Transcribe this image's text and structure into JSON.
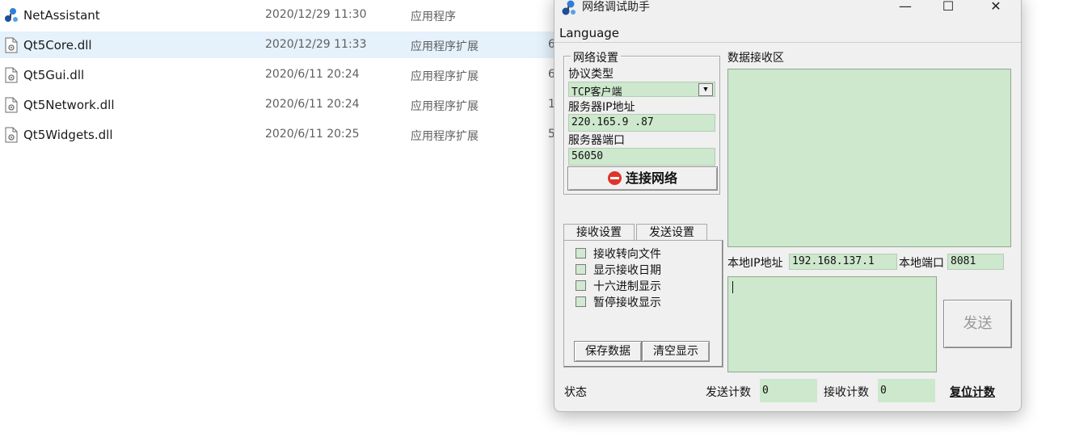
{
  "files": [
    {
      "name": "NetAssistant",
      "date": "2020/12/29 11:30",
      "type": "应用程序",
      "size": "",
      "icon": "app-icon",
      "selected": false
    },
    {
      "name": "Qt5Core.dll",
      "date": "2020/12/29 11:33",
      "type": "应用程序扩展",
      "size": "6",
      "icon": "dll-file-icon",
      "selected": true
    },
    {
      "name": "Qt5Gui.dll",
      "date": "2020/6/11 20:24",
      "type": "应用程序扩展",
      "size": "6",
      "icon": "dll-file-icon",
      "selected": false
    },
    {
      "name": "Qt5Network.dll",
      "date": "2020/6/11 20:24",
      "type": "应用程序扩展",
      "size": "1",
      "icon": "dll-file-icon",
      "selected": false
    },
    {
      "name": "Qt5Widgets.dll",
      "date": "2020/6/11 20:25",
      "type": "应用程序扩展",
      "size": "5",
      "icon": "dll-file-icon",
      "selected": false
    }
  ],
  "window": {
    "title": "网络调试助手",
    "min_glyph": "—",
    "max_glyph": "☐",
    "close_glyph": "✕",
    "menu": [
      "Language"
    ]
  },
  "network": {
    "group_title": "网络设置",
    "protocol_label": "协议类型",
    "protocol_value": "TCP客户端",
    "server_ip_label": "服务器IP地址",
    "server_ip_value": "220.165.9  .87",
    "server_port_label": "服务器端口",
    "server_port_value": "56050",
    "connect_label": "连接网络"
  },
  "tabs": {
    "receive": "接收设置",
    "send": "发送设置"
  },
  "receive_options": [
    {
      "label": "接收转向文件",
      "checked": false
    },
    {
      "label": "显示接收日期",
      "checked": false
    },
    {
      "label": "十六进制显示",
      "checked": false
    },
    {
      "label": "暂停接收显示",
      "checked": false
    }
  ],
  "buttons": {
    "save": "保存数据",
    "clear": "清空显示",
    "send": "发送"
  },
  "receive_area": {
    "title": "数据接收区"
  },
  "local": {
    "ip_label": "本地IP地址",
    "ip_value": "192.168.137.1",
    "port_label": "本地端口",
    "port_value": "8081"
  },
  "status": {
    "label": "状态",
    "send_count_label": "发送计数",
    "send_count_value": "0",
    "recv_count_label": "接收计数",
    "recv_count_value": "0",
    "reset_label": "复位计数"
  },
  "colors": {
    "field_green": "#cde8cd",
    "selection": "#e5f1fb",
    "window_bg": "#f0f0f0",
    "stop_red": "#e0332b"
  }
}
